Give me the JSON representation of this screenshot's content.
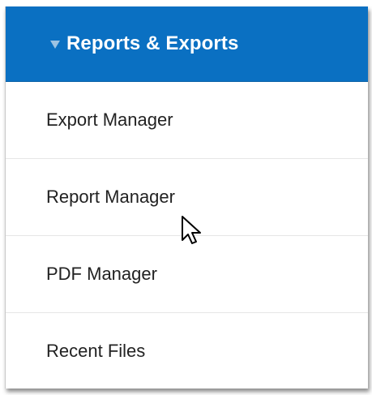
{
  "partial_top_text": "",
  "menu": {
    "header": {
      "title": "Reports & Exports",
      "expanded_icon": "triangle-down-icon"
    },
    "items": [
      {
        "label": "Export Manager"
      },
      {
        "label": "Report Manager"
      },
      {
        "label": "PDF Manager"
      },
      {
        "label": "Recent Files"
      }
    ]
  },
  "colors": {
    "header_bg": "#0a70c2",
    "header_text": "#ffffff",
    "item_text": "#222222",
    "divider": "#e6e6e6"
  },
  "cursor": {
    "icon": "mouse-pointer-icon",
    "hovered_item": "Report Manager"
  }
}
